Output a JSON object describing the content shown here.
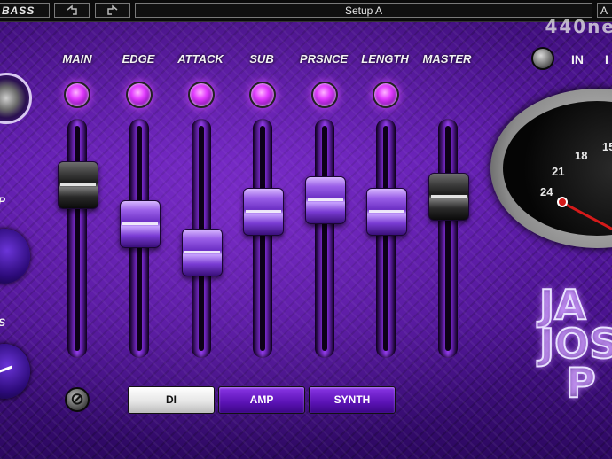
{
  "header": {
    "brand": "BASS",
    "undo_icon": "undo-icon",
    "redo_icon": "redo-icon",
    "preset": "Setup A",
    "right_cut": "A",
    "watermark": "440ne"
  },
  "faders": [
    {
      "label": "MAIN",
      "level": 0.78,
      "cap": "dark"
    },
    {
      "label": "EDGE",
      "level": 0.58,
      "cap": "purple"
    },
    {
      "label": "ATTACK",
      "level": 0.43,
      "cap": "purple"
    },
    {
      "label": "SUB",
      "level": 0.64,
      "cap": "purple"
    },
    {
      "label": "PRSNCE",
      "level": 0.7,
      "cap": "purple"
    },
    {
      "label": "LENGTH",
      "level": 0.64,
      "cap": "purple"
    },
    {
      "label": "MASTER",
      "level": 0.72,
      "cap": "dark"
    }
  ],
  "input": {
    "label": "IN",
    "right_cut": "I"
  },
  "left_controls": {
    "label1": "P",
    "label2": "S"
  },
  "modes": [
    {
      "label": "DI",
      "active": true
    },
    {
      "label": "AMP",
      "active": false
    },
    {
      "label": "SYNTH",
      "active": false
    }
  ],
  "meter": {
    "ticks": [
      "24",
      "21",
      "18",
      "15"
    ]
  },
  "logo": {
    "line1": "JA",
    "line2": "JOS",
    "line3": "P"
  },
  "colors": {
    "accent": "#b030ff",
    "background": "#4a138f",
    "led": "#e23cff"
  }
}
